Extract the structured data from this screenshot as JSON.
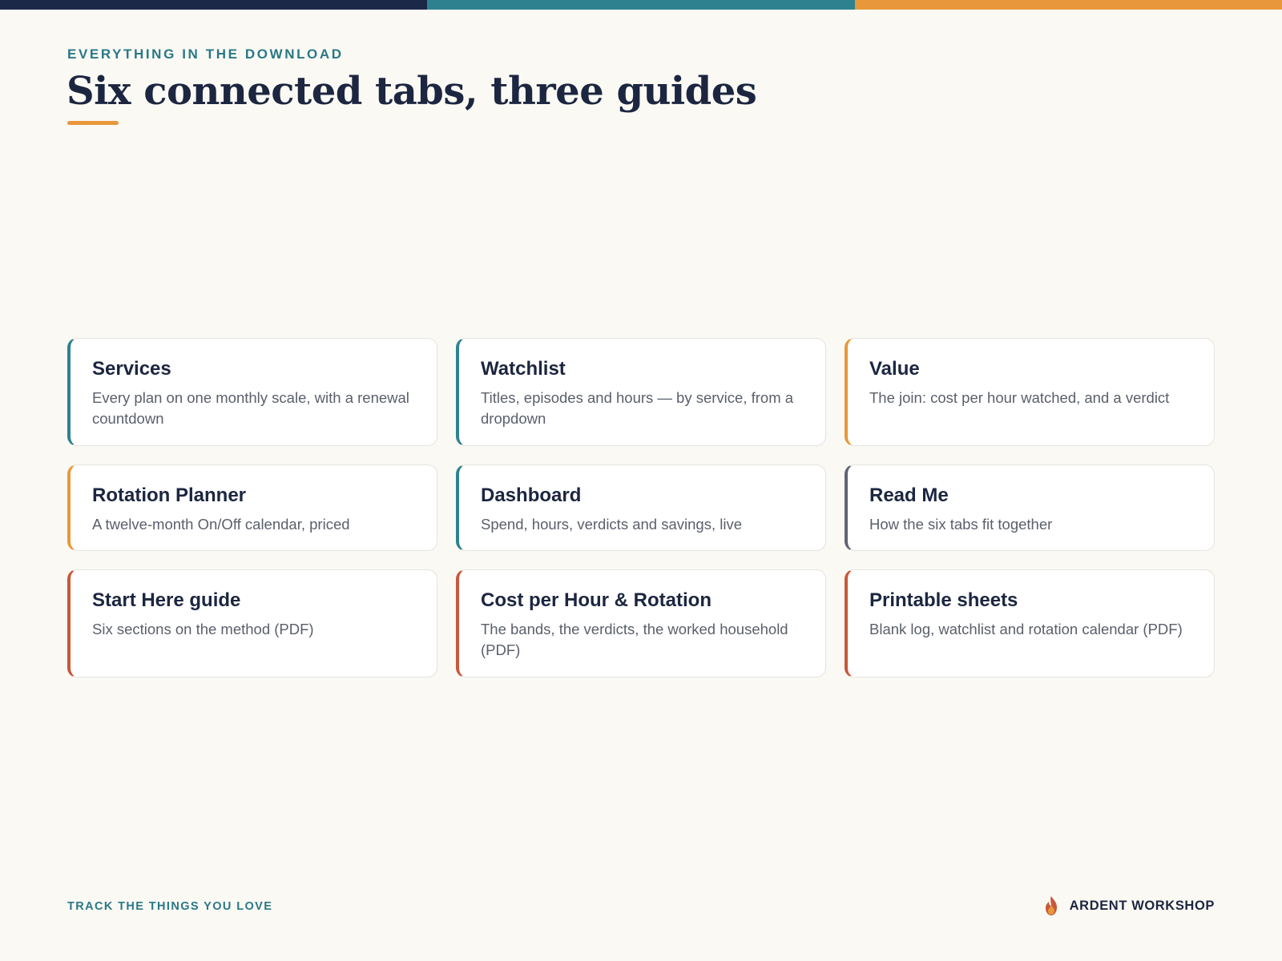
{
  "header": {
    "eyebrow": "EVERYTHING IN THE DOWNLOAD",
    "title": "Six connected tabs, three guides"
  },
  "colors": {
    "navy": "#1c2847",
    "teal": "#2e8290",
    "orange": "#e8983a",
    "slate": "#5f6675",
    "rust": "#c8583a",
    "background": "#faf9f4"
  },
  "cards": [
    {
      "title": "Services",
      "description": "Every plan on one monthly scale, with a renewal countdown",
      "accent": "teal"
    },
    {
      "title": "Watchlist",
      "description": "Titles, episodes and hours — by service, from a dropdown",
      "accent": "teal"
    },
    {
      "title": "Value",
      "description": "The join: cost per hour watched, and a verdict",
      "accent": "orange"
    },
    {
      "title": "Rotation Planner",
      "description": "A twelve-month On/Off calendar, priced",
      "accent": "orange"
    },
    {
      "title": "Dashboard",
      "description": "Spend, hours, verdicts and savings, live",
      "accent": "teal"
    },
    {
      "title": "Read Me",
      "description": "How the six tabs fit together",
      "accent": "slate"
    },
    {
      "title": "Start Here guide",
      "description": "Six sections on the method (PDF)",
      "accent": "rust"
    },
    {
      "title": "Cost per Hour & Rotation",
      "description": "The bands, the verdicts, the worked household (PDF)",
      "accent": "rust"
    },
    {
      "title": "Printable sheets",
      "description": "Blank log, watchlist and rotation calendar (PDF)",
      "accent": "rust"
    }
  ],
  "footer": {
    "tagline": "TRACK THE THINGS YOU LOVE",
    "brand_name": "ARDENT WORKSHOP",
    "brand_icon": "flame-icon"
  }
}
